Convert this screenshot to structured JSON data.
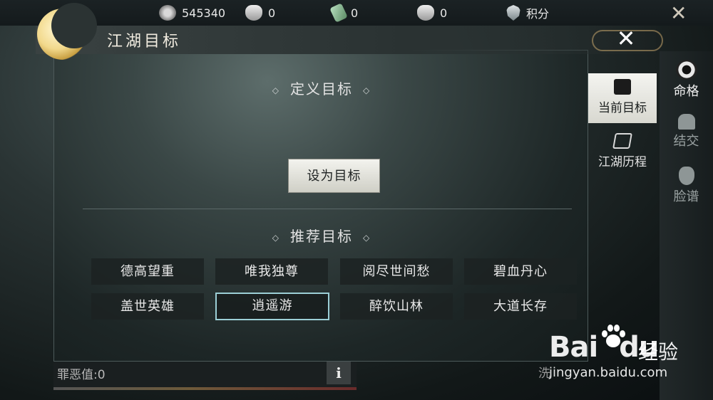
{
  "topbar": {
    "bg_title": "命格",
    "currencies": [
      {
        "icon": "coin-icon",
        "value": "545340"
      },
      {
        "icon": "bowl-plus-icon",
        "value": "0"
      },
      {
        "icon": "jade-plus-icon",
        "value": "0"
      },
      {
        "icon": "bowl-plus-icon",
        "value": "0"
      },
      {
        "icon": "shield-icon",
        "value": "积分"
      }
    ]
  },
  "panel": {
    "title": "江湖目标",
    "define_section_title": "定义目标",
    "set_button_label": "设为目标",
    "recommend_section_title": "推荐目标",
    "recommended": [
      {
        "label": "德高望重",
        "selected": false
      },
      {
        "label": "唯我独尊",
        "selected": false
      },
      {
        "label": "阅尽世间愁",
        "selected": false
      },
      {
        "label": "碧血丹心",
        "selected": false
      },
      {
        "label": "盖世英雄",
        "selected": false
      },
      {
        "label": "逍遥游",
        "selected": true
      },
      {
        "label": "醉饮山林",
        "selected": false
      },
      {
        "label": "大道长存",
        "selected": false
      }
    ],
    "sin_label": "罪恶值:0",
    "info_label": "i",
    "bottom_right_text": "洗"
  },
  "side_tabs": [
    {
      "label": "当前目标",
      "active": true,
      "icon": "scroll-icon"
    },
    {
      "label": "江湖历程",
      "active": false,
      "icon": "scroll-icon"
    }
  ],
  "far_tabs": [
    {
      "label": "命格",
      "active": true,
      "icon": "ring-icon"
    },
    {
      "label": "结交",
      "active": false,
      "icon": "figure-icon"
    },
    {
      "label": "脸谱",
      "active": false,
      "icon": "mask-icon"
    }
  ],
  "watermark": {
    "logo_prefix": "Bai",
    "logo_suffix": "du",
    "logo_cn": "经验",
    "url": "jingyan.baidu.com"
  },
  "colors": {
    "selected_border": "#9ccfd6",
    "button_bg": "#e6e6df",
    "active_tab_bg": "#f0f0ea"
  }
}
